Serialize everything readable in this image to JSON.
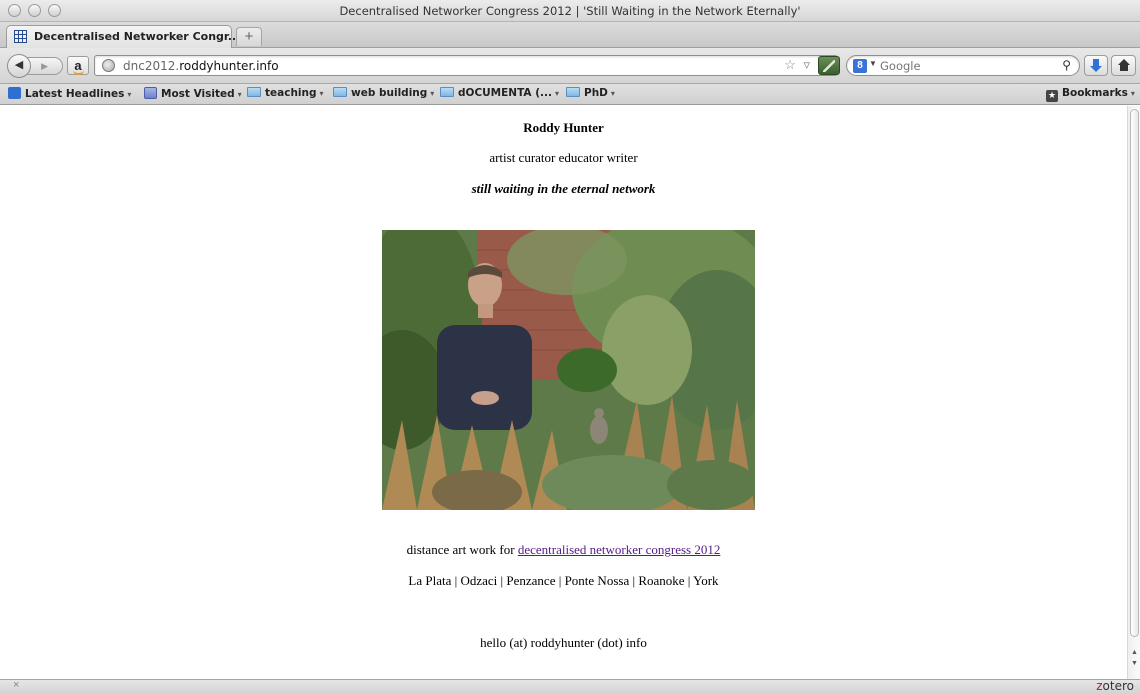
{
  "window": {
    "title": "Decentralised Networker Congress 2012 | 'Still Waiting in the Network Eternally'"
  },
  "tabs": [
    {
      "label": "Decentralised Networker Congr...",
      "active": true,
      "icon": "grid-favicon-icon"
    }
  ],
  "newtab": {
    "label": "+"
  },
  "navbar": {
    "back": "◀",
    "forward": "▶",
    "amazon": "a",
    "url_prefix": "dnc2012.",
    "url_domain": "roddyhunter.info",
    "url_actions": "☆ ▿ C",
    "search_engine": "8",
    "search_placeholder": "Google",
    "search_icon": "⚲"
  },
  "bookmarks": {
    "items": [
      {
        "label": "Latest Headlines",
        "icon": "rss-icon"
      },
      {
        "label": "Most Visited",
        "icon": "most-visited-icon"
      },
      {
        "label": "teaching",
        "icon": "folder-icon"
      },
      {
        "label": "web building",
        "icon": "folder-icon"
      },
      {
        "label": "dOCUMENTA (...",
        "icon": "folder-icon"
      },
      {
        "label": "PhD",
        "icon": "folder-icon"
      }
    ],
    "menu": "Bookmarks",
    "caret": "▾"
  },
  "page": {
    "name": "Roddy Hunter",
    "roles": "artist curator educator writer",
    "tagline": "still waiting in the eternal network",
    "distance_prefix": "distance art work for ",
    "congress_link": "decentralised networker congress 2012",
    "places": "La Plata | Odzaci | Penzance | Ponte Nossa | Roanoke | York",
    "contact": "hello (at) roddyhunter (dot) info"
  },
  "scrollbar": {
    "up": "▲",
    "down": "▼"
  },
  "statusbar": {
    "close": "×",
    "addon_z": "z",
    "addon_rest": "otero"
  },
  "colors": {
    "link": "#551a8b",
    "zotero_red": "#c8102e",
    "chrome_grey": "#d6d6d6"
  }
}
